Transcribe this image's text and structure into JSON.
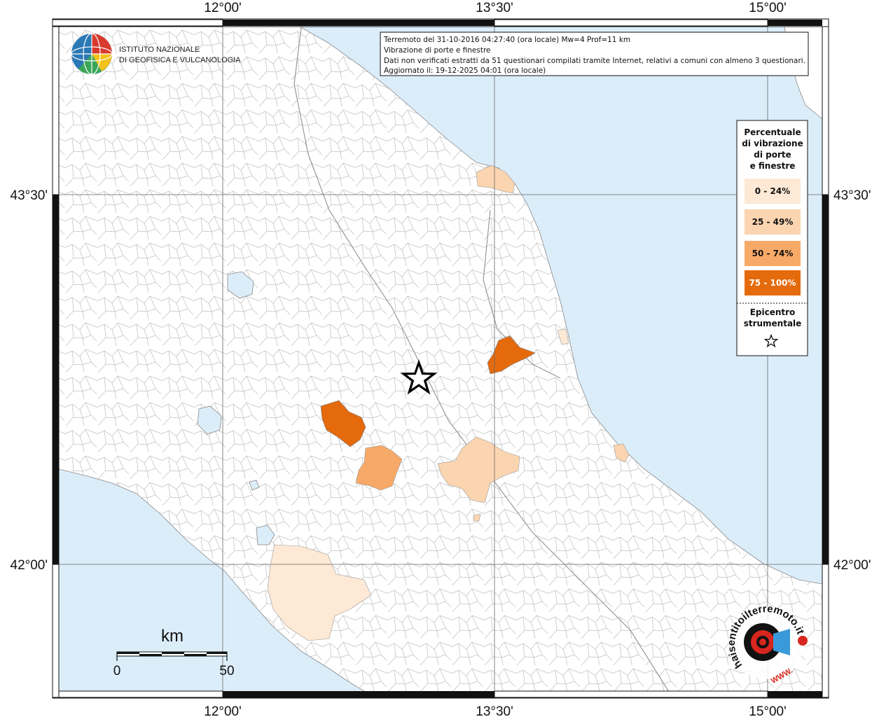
{
  "map": {
    "top_ticks": [
      "12°00'",
      "13°30'",
      "15°00'"
    ],
    "bottom_ticks": [
      "12°00'",
      "13°30'",
      "15°00'"
    ],
    "left_ticks": [
      "43°30'",
      "42°00'"
    ],
    "right_ticks": [
      "43°30'",
      "42°00'"
    ]
  },
  "logo_ingv": {
    "line1": "ISTITUTO NAZIONALE",
    "line2": "DI GEOFISICA E VULCANOLOGIA"
  },
  "info_box": {
    "line1": "Terremoto del 31-10-2016 04:27:40 (ora locale) Mw=4 Prof=11 km",
    "line2": "Vibrazione di porte e finestre",
    "line3": "Dati non verificati estratti da 51 questionari compilati tramite Internet, relativi a comuni con almeno 3 questionari.",
    "line4": "Aggiornato il: 19-12-2025 04:01 (ora locale)"
  },
  "legend": {
    "title1": "Percentuale",
    "title2": "di vibrazione",
    "title3": "di porte",
    "title4": "e finestre",
    "classes": [
      {
        "label": "0 - 24%",
        "color": "#fde9d5"
      },
      {
        "label": "25 - 49%",
        "color": "#fbd5b0"
      },
      {
        "label": "50 - 74%",
        "color": "#f7a967"
      },
      {
        "label": "75 - 100%",
        "color": "#e56a0c"
      }
    ],
    "epi1": "Epicentro",
    "epi2": "strumentale"
  },
  "scale": {
    "unit": "km",
    "start": "0",
    "end": "50"
  },
  "logo_hsn": {
    "text": "haisentitoilterremoto.it",
    "web": "WWW."
  },
  "colors": {
    "sea": "#dcedfa",
    "land": "#ffffff",
    "border": "#b8b8b8"
  }
}
